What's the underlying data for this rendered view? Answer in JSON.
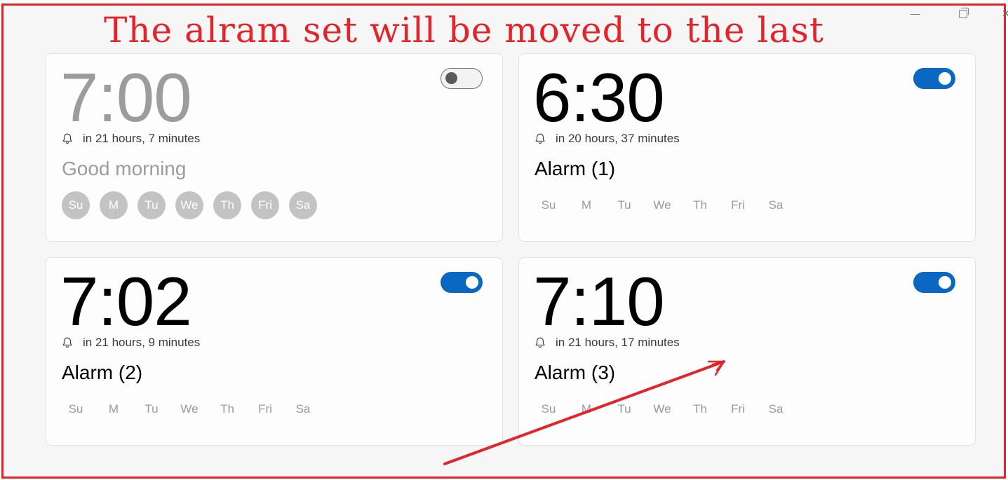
{
  "annotation": {
    "text": "The alram set will be moved to the last"
  },
  "window": {
    "minimize": "minimize",
    "restore": "restore",
    "close": "✕"
  },
  "days_template": [
    "Su",
    "M",
    "Tu",
    "We",
    "Th",
    "Fri",
    "Sa"
  ],
  "alarms": [
    {
      "time": "7:00",
      "remaining": "in 21 hours, 7 minutes",
      "name": "Good morning",
      "enabled": false,
      "days": [
        "Su",
        "M",
        "Tu",
        "We",
        "Th",
        "Fri",
        "Sa"
      ],
      "days_selected": true
    },
    {
      "time": "6:30",
      "remaining": "in 20 hours, 37 minutes",
      "name": "Alarm (1)",
      "enabled": true,
      "days": [
        "Su",
        "M",
        "Tu",
        "We",
        "Th",
        "Fri",
        "Sa"
      ],
      "days_selected": false
    },
    {
      "time": "7:02",
      "remaining": "in 21 hours, 9 minutes",
      "name": "Alarm (2)",
      "enabled": true,
      "days": [
        "Su",
        "M",
        "Tu",
        "We",
        "Th",
        "Fri",
        "Sa"
      ],
      "days_selected": false
    },
    {
      "time": "7:10",
      "remaining": "in 21 hours, 17 minutes",
      "name": "Alarm (3)",
      "enabled": true,
      "days": [
        "Su",
        "M",
        "Tu",
        "We",
        "Th",
        "Fri",
        "Sa"
      ],
      "days_selected": false
    }
  ],
  "colors": {
    "accent": "#0a67c2",
    "annotation": "#e3242b",
    "disabled_text": "#9c9c9c"
  }
}
